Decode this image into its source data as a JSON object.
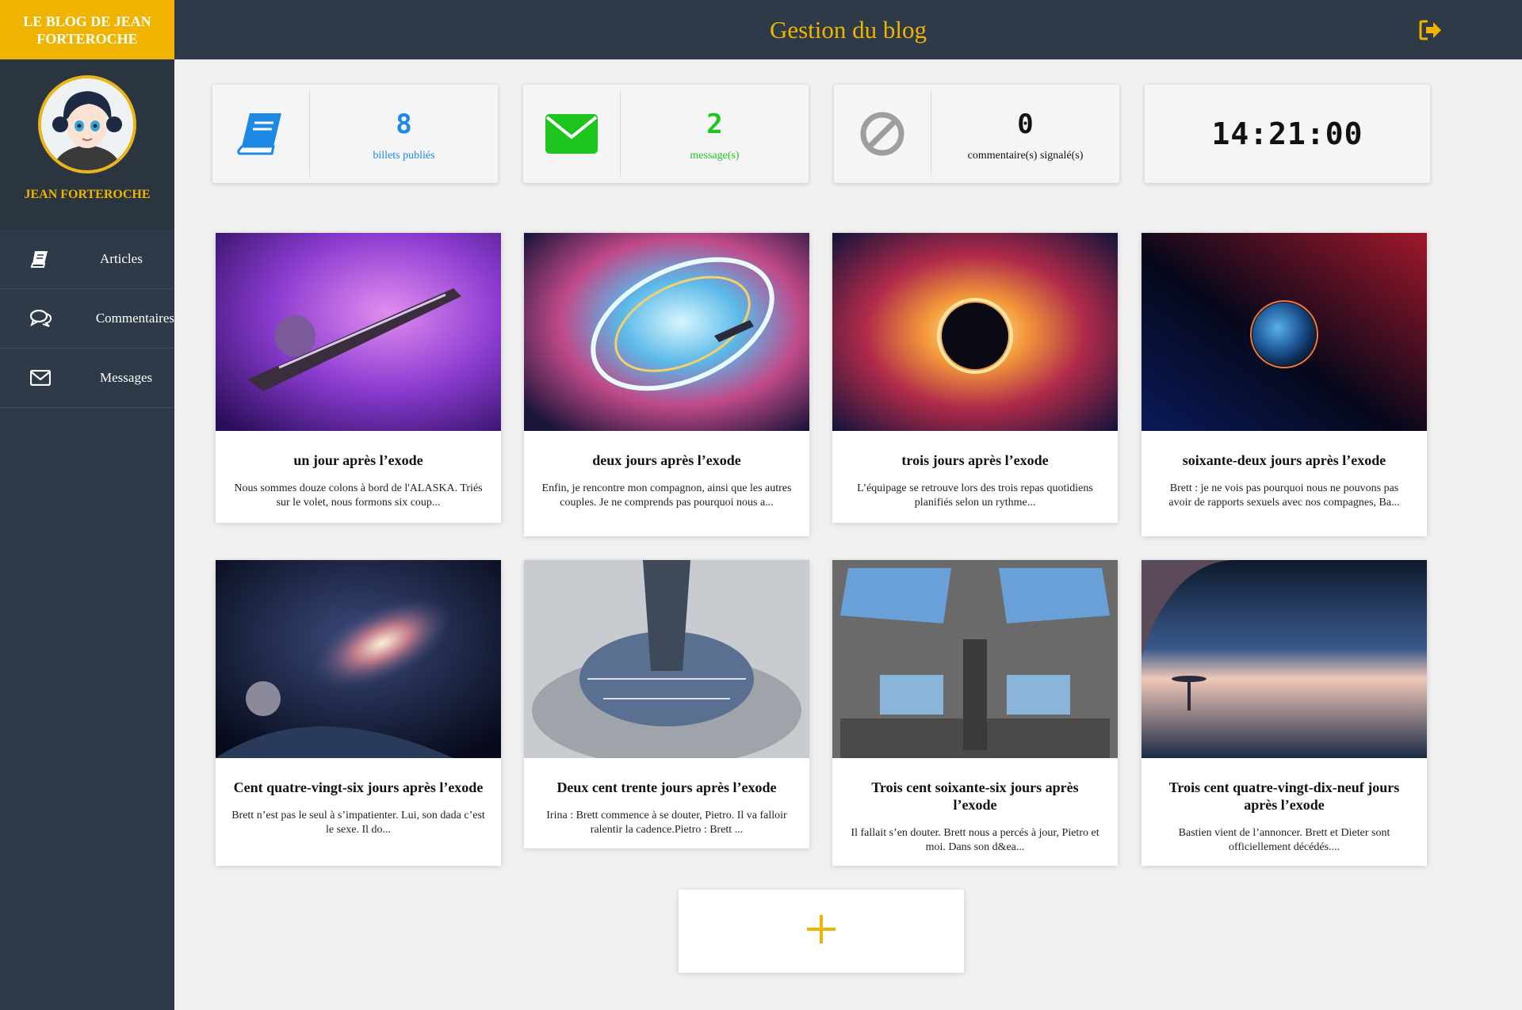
{
  "sidebar": {
    "brand": "LE BLOG DE JEAN FORTEROCHE",
    "username": "JEAN FORTEROCHE",
    "items": [
      {
        "label": "Articles",
        "icon": "book-icon"
      },
      {
        "label": "Commentaires",
        "icon": "comments-icon"
      },
      {
        "label": "Messages",
        "icon": "envelope-icon"
      }
    ]
  },
  "header": {
    "title": "Gestion du blog",
    "logout_icon": "logout-icon"
  },
  "stats": [
    {
      "value": "8",
      "label": "billets publiés",
      "icon": "book-icon",
      "color": "#1e88e5"
    },
    {
      "value": "2",
      "label": "message(s)",
      "icon": "envelope-icon",
      "color": "#1ec51e"
    },
    {
      "value": "0",
      "label": "commentaire(s) signalé(s)",
      "icon": "ban-icon",
      "color": "#111111"
    }
  ],
  "clock": "14:21:00",
  "articles": [
    {
      "title": "un jour après l’exode",
      "excerpt": "Nous sommes douze colons à bord de l'ALASKA. Triés sur le volet, nous formons six coup..."
    },
    {
      "title": "deux jours après l’exode",
      "excerpt": "Enfin, je rencontre mon compagnon, ainsi que les autres couples. Je ne comprends pas pourquoi nous a..."
    },
    {
      "title": "trois jours après l’exode",
      "excerpt": "L’équipage se retrouve lors des trois repas quotidiens planifiés selon un rythme..."
    },
    {
      "title": "soixante-deux jours après l’exode",
      "excerpt": "Brett : je ne vois pas pourquoi nous ne pouvons pas avoir de rapports sexuels avec nos compagnes, Ba..."
    },
    {
      "title": "Cent quatre-vingt-six jours après l’exode",
      "excerpt": "Brett n’est pas le seul à s’impatienter. Lui, son dada c’est le sexe. Il do..."
    },
    {
      "title": "Deux cent trente jours après l’exode",
      "excerpt": "Irina : Brett commence à se douter, Pietro. Il va falloir ralentir la cadence.Pietro : Brett ..."
    },
    {
      "title": "Trois cent soixante-six jours après l’exode",
      "excerpt": "Il fallait s’en douter. Brett nous a percés à jour, Pietro et moi. Dans son d&ea..."
    },
    {
      "title": "Trois cent quatre-vingt-dix-neuf jours après l’exode",
      "excerpt": "Bastien vient de l’annoncer. Brett et Dieter sont officiellement décédés...."
    }
  ],
  "add_button": {
    "icon": "plus-icon"
  },
  "colors": {
    "accent": "#f0b400",
    "sidebar": "#2e3a47",
    "background": "#f0f0f0"
  }
}
